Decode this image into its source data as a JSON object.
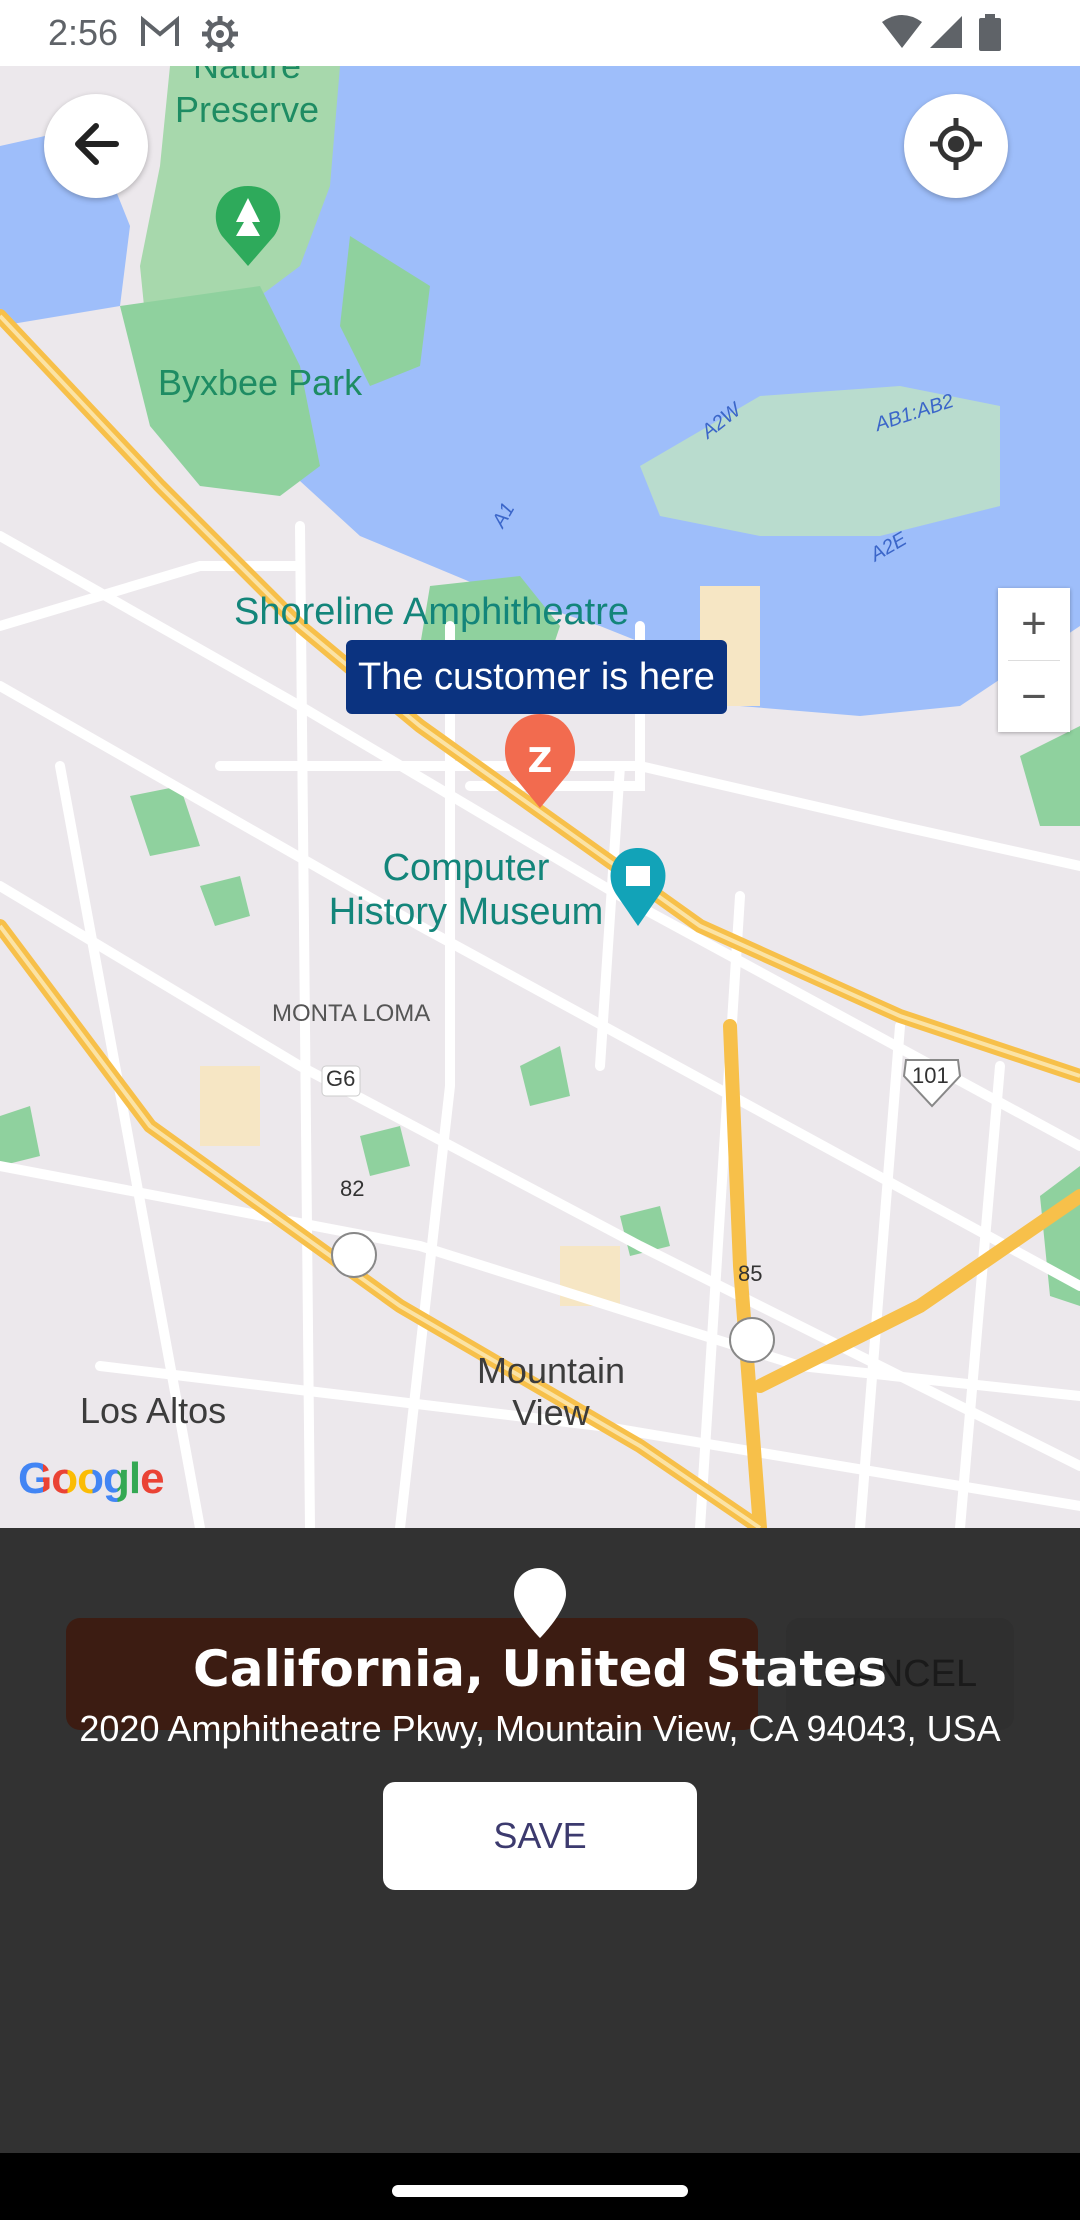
{
  "status_bar": {
    "time": "2:56"
  },
  "map": {
    "labels": {
      "nature_preserve_line1": "Nature",
      "nature_preserve_line2": "Preserve",
      "byxbee_park": "Byxbee Park",
      "shoreline": "Shoreline Amphitheatre",
      "computer_history_line1": "Computer",
      "computer_history_line2": "History Museum",
      "monta_loma": "MONTA LOMA",
      "los_altos": "Los Altos",
      "mountain_view_line1": "Mountain",
      "mountain_view_line2": "View",
      "a2w": "A2W",
      "ab1ab2": "AB1:AB2",
      "a1": "A1",
      "a2e": "A2E",
      "g6": "G6",
      "r82": "82",
      "r85": "85",
      "r101": "101"
    },
    "marker_tooltip": "The customer is here",
    "zoom_in": "+",
    "zoom_out": "−",
    "attribution": "Google"
  },
  "sheet": {
    "hidden_cancel_label": "CANCEL",
    "place_title": "California, United States",
    "place_address": "2020 Amphitheatre Pkwy, Mountain View, CA 94043, USA",
    "save_label": "SAVE"
  },
  "colors": {
    "water": "#9ebefa",
    "park": "#8fd19e",
    "highway": "#f7c04a",
    "tooltip_bg": "#0b3380",
    "marker": "#f26b4f",
    "sheet_bg": "#323232"
  }
}
